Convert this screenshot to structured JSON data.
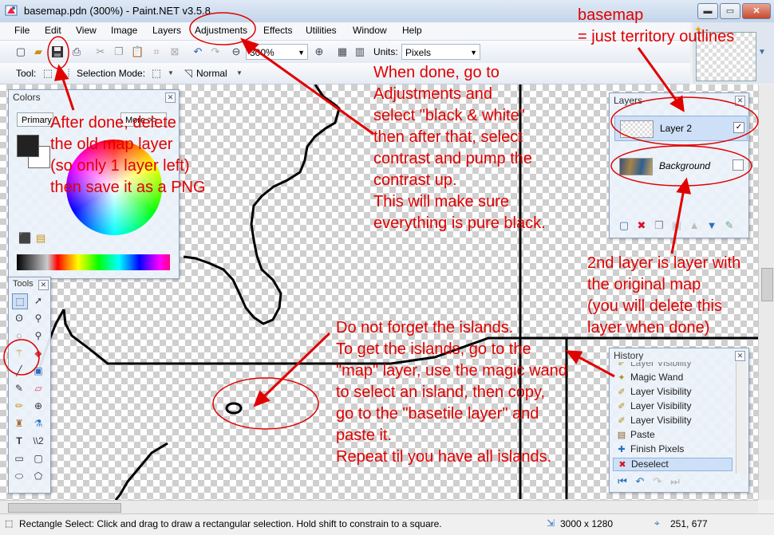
{
  "window": {
    "title": "basemap.pdn (300%) - Paint.NET v3.5.8",
    "controls": {
      "minimize": "▬",
      "maximize": "▭",
      "close": "✕"
    }
  },
  "menu": [
    "File",
    "Edit",
    "View",
    "Image",
    "Layers",
    "Adjustments",
    "Effects",
    "Utilities",
    "Window",
    "Help"
  ],
  "toolbar": {
    "zoom_value": "300%",
    "units_label": "Units:",
    "units_value": "Pixels",
    "tool_label": "Tool:",
    "selection_mode_label": "Selection Mode:",
    "blend_mode": "Normal"
  },
  "colors_panel": {
    "title": "Colors",
    "primary_label": "Primary",
    "more_label": "More >>",
    "primary_color": "#222222",
    "secondary_color": "#ffffff"
  },
  "tools_panel": {
    "title": "Tools"
  },
  "layers_panel": {
    "title": "Layers",
    "layers": [
      {
        "name": "Layer 2",
        "visible": true,
        "selected": true
      },
      {
        "name": "Background",
        "visible": false,
        "selected": false
      }
    ]
  },
  "history_panel": {
    "title": "History",
    "items": [
      {
        "label": "Layer Visibility",
        "icon": "visibility-icon"
      },
      {
        "label": "Magic Wand",
        "icon": "magic-wand-icon"
      },
      {
        "label": "Layer Visibility",
        "icon": "visibility-icon"
      },
      {
        "label": "Layer Visibility",
        "icon": "visibility-icon"
      },
      {
        "label": "Layer Visibility",
        "icon": "visibility-icon"
      },
      {
        "label": "Paste",
        "icon": "paste-icon"
      },
      {
        "label": "Finish Pixels",
        "icon": "finish-pixels-icon"
      },
      {
        "label": "Deselect",
        "icon": "deselect-icon",
        "selected": true
      }
    ]
  },
  "status": {
    "hint": "Rectangle Select: Click and drag to draw a rectangular selection. Hold shift to constrain to a square.",
    "image_size": "3000 x 1280",
    "cursor_pos": "251, 677"
  },
  "annotations": {
    "basemap": "basemap\n= just territory outlines",
    "adjustments": "When done, go to\nAdjustments and\nselect \"black & white\"\nthen after that, select\ncontrast and pump the\ncontrast up.\nThis will make sure\neverything is pure black.",
    "delete_layer": "After done, delete\nthe old map layer\n(so only 1 layer left)\nthen save it as a PNG",
    "second_layer": "2nd layer is layer with\nthe original map\n(you will delete this\nlayer when done)",
    "islands": "Do not forget the islands.\nTo get the islands, go to the\n\"map\" layer, use the magic wand\nto select an island, then copy,\ngo to the \"basetile layer\" and\npaste it.\nRepeat til you have all islands.",
    "color": "#e00000"
  }
}
